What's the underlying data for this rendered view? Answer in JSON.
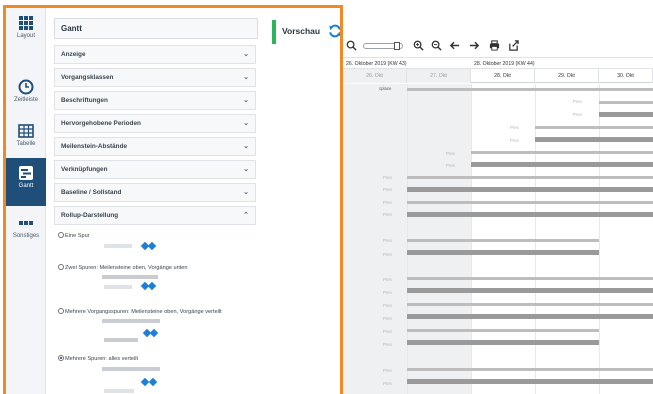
{
  "nav": [
    {
      "label": "Layout",
      "icon": "grid-icon",
      "active": false
    },
    {
      "label": "Zeitleiste",
      "icon": "clock-icon",
      "active": false
    },
    {
      "label": "Tabelle",
      "icon": "table-icon",
      "active": false
    },
    {
      "label": "Gantt",
      "icon": "gantt-icon",
      "active": true
    },
    {
      "label": "Sonstiges",
      "icon": "more-icon",
      "active": false
    }
  ],
  "panel": {
    "title": "Gantt",
    "sections": [
      "Anzeige",
      "Vorgangsklassen",
      "Beschriftungen",
      "Hervorgehobene Perioden",
      "Meilenstein-Abstände",
      "Verknüpfungen",
      "Baseline / Sollstand",
      "Rollup-Darstellung"
    ],
    "rollup_options": [
      {
        "label": "Eine Spur",
        "selected": false
      },
      {
        "label": "Zwei Spuren: Meilensteine oben, Vorgänge unten",
        "selected": false
      },
      {
        "label": "Mehrere Vorgangsspuren: Meilensteine oben, Vorgänge verteilt",
        "selected": false
      },
      {
        "label": "Mehrere Spuren: alles verteilt",
        "selected": true
      }
    ]
  },
  "preview": {
    "label": "Vorschau",
    "accent": "#2db45a"
  },
  "colors": {
    "frame": "#f08a24",
    "nav_active": "#1f4e79",
    "milestone": "#1e7fd8",
    "bar": "#9a9a9a"
  },
  "gantt": {
    "toolbar_icons": [
      "search-icon",
      "zoom-in-icon",
      "zoom-out-icon",
      "arrow-left-icon",
      "arrow-right-icon",
      "print-icon",
      "export-icon"
    ],
    "weeks": [
      "26. Oktober 2019 (KW 43)",
      "28. Oktober 2019 (KW 44)"
    ],
    "days": [
      "26. Okt",
      "27. Okt",
      "28. Okt",
      "29. Okt",
      "30. Okt"
    ],
    "first_row_label": "cplace",
    "row_label": "Pres"
  }
}
